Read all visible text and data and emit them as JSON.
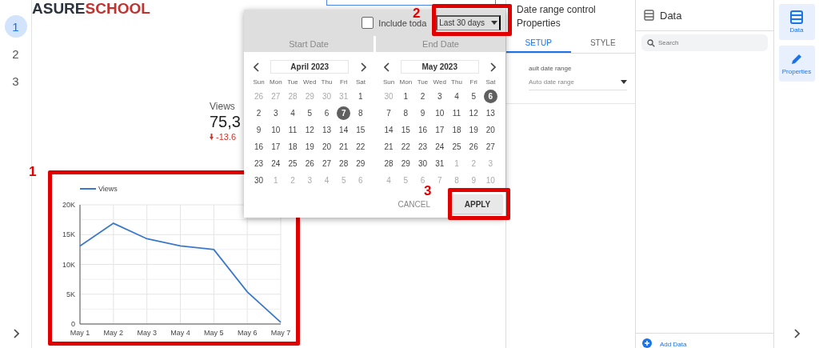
{
  "pages": [
    {
      "label": "1",
      "selected": true
    },
    {
      "label": "2",
      "selected": false
    },
    {
      "label": "3",
      "selected": false
    }
  ],
  "logo": {
    "part_1": "ASURE",
    "part_2": "SCHOOL"
  },
  "scorecard": {
    "label": "Views",
    "value": "75,3",
    "delta": "-13.6"
  },
  "chart_card": {
    "chart_data": {
      "type": "line",
      "grid": true,
      "categories": [
        "May 1",
        "May 2",
        "May 3",
        "May 4",
        "May 5",
        "May 6",
        "May 7"
      ],
      "series": [
        {
          "name": "Views",
          "color": "#3b78c8",
          "values": [
            13100,
            16900,
            14300,
            13100,
            12500,
            5400,
            300
          ]
        }
      ],
      "ylim": [
        0,
        20000
      ],
      "yticks": [
        {
          "value": 0,
          "label": "0"
        },
        {
          "value": 5000,
          "label": "5K"
        },
        {
          "value": 10000,
          "label": "10K"
        },
        {
          "value": 15000,
          "label": "15K"
        },
        {
          "value": 20000,
          "label": "20K"
        }
      ]
    }
  },
  "date_picker": {
    "include_today": {
      "label": "Include toda",
      "checked": false
    },
    "preset": "Last 30 days",
    "tabs": [
      "Start Date",
      "End Date"
    ],
    "calendars": [
      {
        "month": "April 2023",
        "weekdays": [
          "Sun",
          "Mon",
          "Tue",
          "Wed",
          "Thu",
          "Fri",
          "Sat"
        ],
        "days": [
          {
            "day": "26",
            "muted": true,
            "selected": false
          },
          {
            "day": "27",
            "muted": true,
            "selected": false
          },
          {
            "day": "28",
            "muted": true,
            "selected": false
          },
          {
            "day": "29",
            "muted": true,
            "selected": false
          },
          {
            "day": "30",
            "muted": true,
            "selected": false
          },
          {
            "day": "31",
            "muted": true,
            "selected": false
          },
          {
            "day": "1",
            "muted": false,
            "selected": false
          },
          {
            "day": "2",
            "muted": false,
            "selected": false
          },
          {
            "day": "3",
            "muted": false,
            "selected": false
          },
          {
            "day": "4",
            "muted": false,
            "selected": false
          },
          {
            "day": "5",
            "muted": false,
            "selected": false
          },
          {
            "day": "6",
            "muted": false,
            "selected": false
          },
          {
            "day": "7",
            "muted": false,
            "selected": true
          },
          {
            "day": "8",
            "muted": false,
            "selected": false
          },
          {
            "day": "9",
            "muted": false,
            "selected": false
          },
          {
            "day": "10",
            "muted": false,
            "selected": false
          },
          {
            "day": "11",
            "muted": false,
            "selected": false
          },
          {
            "day": "12",
            "muted": false,
            "selected": false
          },
          {
            "day": "13",
            "muted": false,
            "selected": false
          },
          {
            "day": "14",
            "muted": false,
            "selected": false
          },
          {
            "day": "15",
            "muted": false,
            "selected": false
          },
          {
            "day": "16",
            "muted": false,
            "selected": false
          },
          {
            "day": "17",
            "muted": false,
            "selected": false
          },
          {
            "day": "18",
            "muted": false,
            "selected": false
          },
          {
            "day": "19",
            "muted": false,
            "selected": false
          },
          {
            "day": "20",
            "muted": false,
            "selected": false
          },
          {
            "day": "21",
            "muted": false,
            "selected": false
          },
          {
            "day": "22",
            "muted": false,
            "selected": false
          },
          {
            "day": "23",
            "muted": false,
            "selected": false
          },
          {
            "day": "24",
            "muted": false,
            "selected": false
          },
          {
            "day": "25",
            "muted": false,
            "selected": false
          },
          {
            "day": "26",
            "muted": false,
            "selected": false
          },
          {
            "day": "27",
            "muted": false,
            "selected": false
          },
          {
            "day": "28",
            "muted": false,
            "selected": false
          },
          {
            "day": "29",
            "muted": false,
            "selected": false
          },
          {
            "day": "30",
            "muted": false,
            "selected": false
          },
          {
            "day": "1",
            "muted": true,
            "selected": false
          },
          {
            "day": "2",
            "muted": true,
            "selected": false
          },
          {
            "day": "3",
            "muted": true,
            "selected": false
          },
          {
            "day": "4",
            "muted": true,
            "selected": false
          },
          {
            "day": "5",
            "muted": true,
            "selected": false
          },
          {
            "day": "6",
            "muted": true,
            "selected": false
          }
        ]
      },
      {
        "month": "May 2023",
        "weekdays": [
          "Sun",
          "Mon",
          "Tue",
          "Wed",
          "Thu",
          "Fri",
          "Sat"
        ],
        "days": [
          {
            "day": "30",
            "muted": true,
            "selected": false
          },
          {
            "day": "1",
            "muted": false,
            "selected": false
          },
          {
            "day": "2",
            "muted": false,
            "selected": false
          },
          {
            "day": "3",
            "muted": false,
            "selected": false
          },
          {
            "day": "4",
            "muted": false,
            "selected": false
          },
          {
            "day": "5",
            "muted": false,
            "selected": false
          },
          {
            "day": "6",
            "muted": false,
            "selected": true
          },
          {
            "day": "7",
            "muted": false,
            "selected": false
          },
          {
            "day": "8",
            "muted": false,
            "selected": false
          },
          {
            "day": "9",
            "muted": false,
            "selected": false
          },
          {
            "day": "10",
            "muted": false,
            "selected": false
          },
          {
            "day": "11",
            "muted": false,
            "selected": false
          },
          {
            "day": "12",
            "muted": false,
            "selected": false
          },
          {
            "day": "13",
            "muted": false,
            "selected": false
          },
          {
            "day": "14",
            "muted": false,
            "selected": false
          },
          {
            "day": "15",
            "muted": false,
            "selected": false
          },
          {
            "day": "16",
            "muted": false,
            "selected": false
          },
          {
            "day": "17",
            "muted": false,
            "selected": false
          },
          {
            "day": "18",
            "muted": false,
            "selected": false
          },
          {
            "day": "19",
            "muted": false,
            "selected": false
          },
          {
            "day": "20",
            "muted": false,
            "selected": false
          },
          {
            "day": "21",
            "muted": false,
            "selected": false
          },
          {
            "day": "22",
            "muted": false,
            "selected": false
          },
          {
            "day": "23",
            "muted": false,
            "selected": false
          },
          {
            "day": "24",
            "muted": false,
            "selected": false
          },
          {
            "day": "25",
            "muted": false,
            "selected": false
          },
          {
            "day": "26",
            "muted": false,
            "selected": false
          },
          {
            "day": "27",
            "muted": false,
            "selected": false
          },
          {
            "day": "28",
            "muted": false,
            "selected": false
          },
          {
            "day": "29",
            "muted": false,
            "selected": false
          },
          {
            "day": "30",
            "muted": false,
            "selected": false
          },
          {
            "day": "31",
            "muted": false,
            "selected": false
          },
          {
            "day": "1",
            "muted": true,
            "selected": false
          },
          {
            "day": "2",
            "muted": true,
            "selected": false
          },
          {
            "day": "3",
            "muted": true,
            "selected": false
          },
          {
            "day": "4",
            "muted": true,
            "selected": false
          },
          {
            "day": "5",
            "muted": true,
            "selected": false
          },
          {
            "day": "6",
            "muted": true,
            "selected": false
          },
          {
            "day": "7",
            "muted": true,
            "selected": false
          },
          {
            "day": "8",
            "muted": true,
            "selected": false
          },
          {
            "day": "9",
            "muted": true,
            "selected": false
          },
          {
            "day": "10",
            "muted": true,
            "selected": false
          }
        ]
      }
    ],
    "buttons": [
      {
        "label": "CANCEL",
        "kind": "text"
      },
      {
        "label": "APPLY",
        "kind": "raised"
      }
    ]
  },
  "properties": {
    "title": "Date range control Properties",
    "tabs": [
      {
        "label": "SETUP",
        "selected": true
      },
      {
        "label": "STYLE",
        "selected": false
      }
    ],
    "field_label": "ault date range",
    "dropdown": {
      "placeholder": "Auto date range"
    }
  },
  "data_panel": {
    "title": "Data",
    "search": {
      "placeholder": "Search"
    },
    "add_label": "Add Data"
  },
  "side_tabs": [
    {
      "label": "Data",
      "kind": "data"
    },
    {
      "label": "Properties",
      "kind": "properties"
    }
  ],
  "annotations": [
    {
      "number": "1"
    },
    {
      "number": "2"
    },
    {
      "number": "3"
    }
  ]
}
